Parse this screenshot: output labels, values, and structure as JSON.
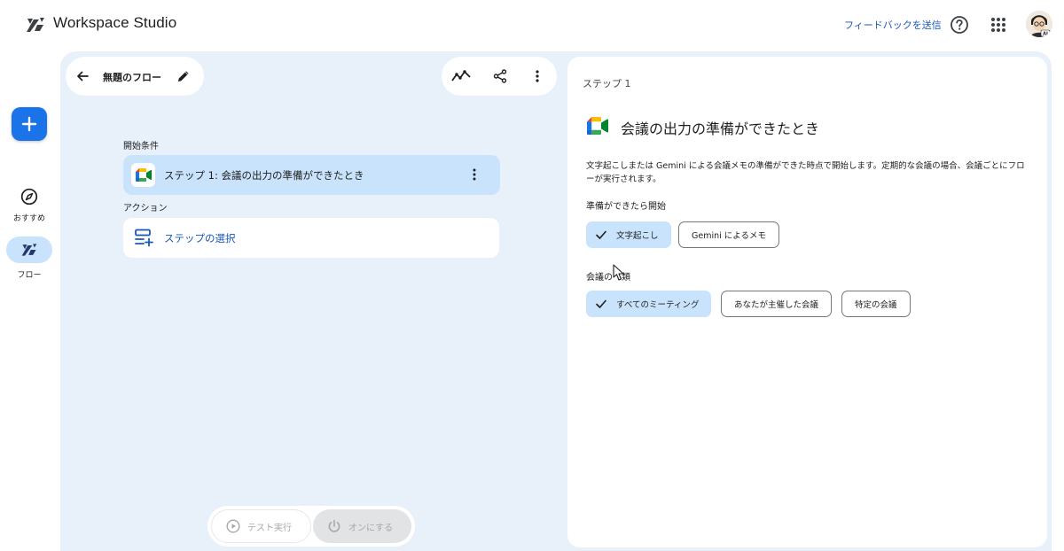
{
  "header": {
    "app_title": "Workspace Studio",
    "feedback_label": "フィードバックを送信",
    "avatar_text": "AI"
  },
  "rail": {
    "items": [
      {
        "label": "おすすめ",
        "icon": "compass-icon"
      },
      {
        "label": "フロー",
        "icon": "flow-icon"
      }
    ]
  },
  "flow": {
    "name": "無題のフロー",
    "start_section_label": "開始条件",
    "trigger_step_label": "ステップ 1: 会議の出力の準備ができたとき",
    "action_section_label": "アクション",
    "action_placeholder": "ステップの選択",
    "test_run_label": "テスト実行",
    "turn_on_label": "オンにする"
  },
  "panel": {
    "step_heading": "ステップ 1",
    "title": "会議の出力の準備ができたとき",
    "description": "文字起こしまたは Gemini による会議メモの準備ができた時点で開始します。定期的な会議の場合、会議ごとにフローが実行されます。",
    "ready_section_label": "準備ができたら開始",
    "ready_options": [
      {
        "label": "文字起こし",
        "selected": true
      },
      {
        "label": "Gemini によるメモ",
        "selected": false
      }
    ],
    "meeting_type_label": "会議の種類",
    "meeting_type_visible_prefix": "会議の",
    "meeting_type_visible_suffix": "類",
    "meeting_options": [
      {
        "label": "すべてのミーティング",
        "selected": true
      },
      {
        "label": "あなたが主催した会議",
        "selected": false
      },
      {
        "label": "特定の会議",
        "selected": false
      }
    ]
  },
  "colors": {
    "accent": "#1a73e8",
    "selected_bg": "#c8e3fb",
    "canvas_bg": "#e8f0fa",
    "link": "#1a56b8"
  }
}
